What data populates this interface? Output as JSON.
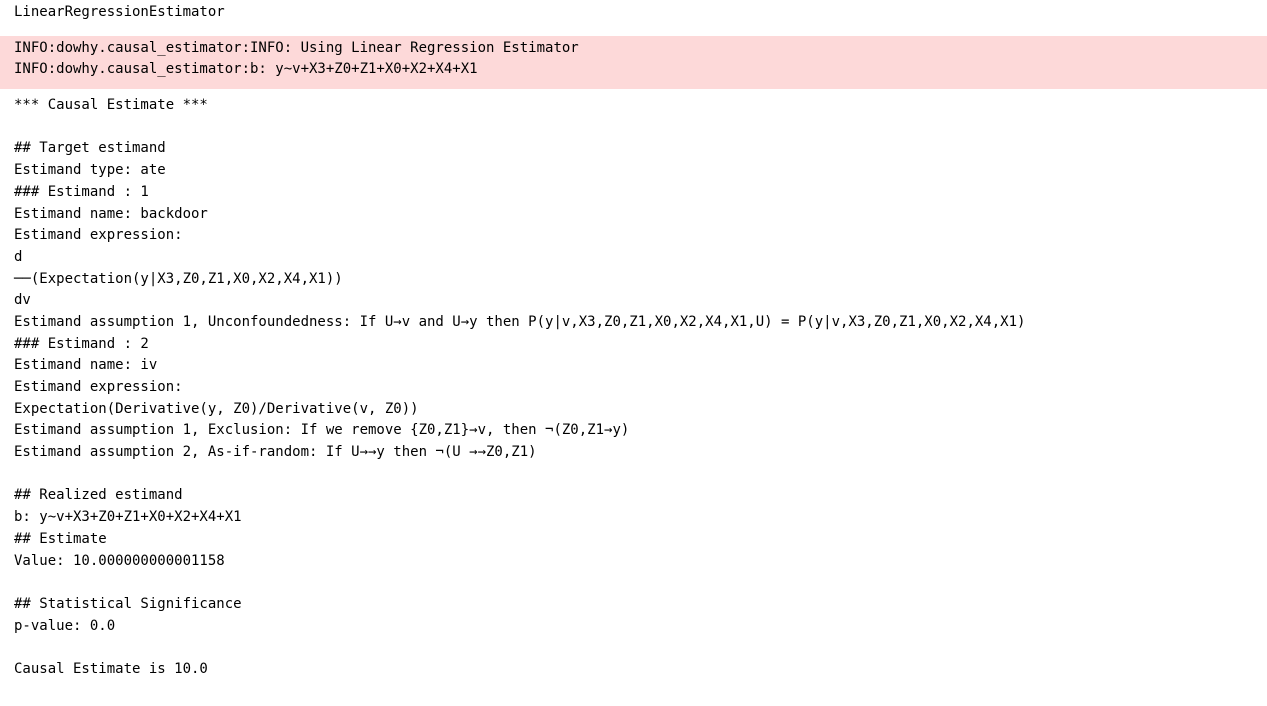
{
  "out_header": "LinearRegressionEstimator",
  "stderr": "INFO:dowhy.causal_estimator:INFO: Using Linear Regression Estimator\nINFO:dowhy.causal_estimator:b: y~v+X3+Z0+Z1+X0+X2+X4+X1",
  "out_body": "*** Causal Estimate ***\n\n## Target estimand\nEstimand type: ate\n### Estimand : 1\nEstimand name: backdoor\nEstimand expression:\nd\n──(Expectation(y|X3,Z0,Z1,X0,X2,X4,X1))\ndv\nEstimand assumption 1, Unconfoundedness: If U→v and U→y then P(y|v,X3,Z0,Z1,X0,X2,X4,X1,U) = P(y|v,X3,Z0,Z1,X0,X2,X4,X1)\n### Estimand : 2\nEstimand name: iv\nEstimand expression:\nExpectation(Derivative(y, Z0)/Derivative(v, Z0))\nEstimand assumption 1, Exclusion: If we remove {Z0,Z1}→v, then ¬(Z0,Z1→y)\nEstimand assumption 2, As-if-random: If U→→y then ¬(U →→Z0,Z1)\n\n## Realized estimand\nb: y~v+X3+Z0+Z1+X0+X2+X4+X1\n## Estimate\nValue: 10.000000000001158\n\n## Statistical Significance\np-value: 0.0\n\nCausal Estimate is 10.0"
}
